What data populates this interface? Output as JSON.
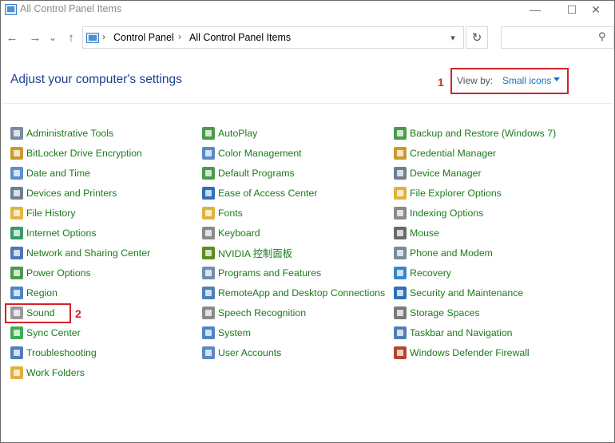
{
  "window": {
    "title": "All Control Panel Items",
    "controls": {
      "minimize": "—",
      "maximize": "☐",
      "close": "✕"
    }
  },
  "nav": {
    "back": "←",
    "forward": "→",
    "recent": "⌄",
    "up": "↑",
    "breadcrumb": [
      "Control Panel",
      "All Control Panel Items"
    ],
    "refresh": "↻",
    "search_placeholder": ""
  },
  "header": {
    "title": "Adjust your computer's settings",
    "view_by_label": "View by:",
    "view_by_value": "Small icons"
  },
  "annotations": {
    "view_by_marker": "1",
    "sound_marker": "2",
    "color": "#d3222b"
  },
  "items": {
    "col1": [
      {
        "label": "Administrative Tools",
        "icon": "admin-tools-icon",
        "color": "#7a8aa0"
      },
      {
        "label": "BitLocker Drive Encryption",
        "icon": "bitlocker-icon",
        "color": "#c99a2e"
      },
      {
        "label": "Date and Time",
        "icon": "clock-icon",
        "color": "#5b8fcf"
      },
      {
        "label": "Devices and Printers",
        "icon": "printer-icon",
        "color": "#6f7f8f"
      },
      {
        "label": "File History",
        "icon": "file-history-icon",
        "color": "#e3b53d"
      },
      {
        "label": "Internet Options",
        "icon": "globe-icon",
        "color": "#3a9a6a"
      },
      {
        "label": "Network and Sharing Center",
        "icon": "network-icon",
        "color": "#4a78b8"
      },
      {
        "label": "Power Options",
        "icon": "battery-icon",
        "color": "#4c9a4c"
      },
      {
        "label": "Region",
        "icon": "region-icon",
        "color": "#4f86c6"
      },
      {
        "label": "Sound",
        "icon": "speaker-icon",
        "color": "#9a9a9a"
      },
      {
        "label": "Sync Center",
        "icon": "sync-icon",
        "color": "#3cae4f"
      },
      {
        "label": "Troubleshooting",
        "icon": "troubleshoot-icon",
        "color": "#4f7fb8"
      },
      {
        "label": "Work Folders",
        "icon": "folder-icon",
        "color": "#e2b13c"
      }
    ],
    "col2": [
      {
        "label": "AutoPlay",
        "icon": "autoplay-icon",
        "color": "#4c9a4c"
      },
      {
        "label": "Color Management",
        "icon": "color-icon",
        "color": "#5a8ac6"
      },
      {
        "label": "Default Programs",
        "icon": "default-programs-icon",
        "color": "#4c9a4c"
      },
      {
        "label": "Ease of Access Center",
        "icon": "accessibility-icon",
        "color": "#2f6fb8"
      },
      {
        "label": "Fonts",
        "icon": "fonts-icon",
        "color": "#e0b43a"
      },
      {
        "label": "Keyboard",
        "icon": "keyboard-icon",
        "color": "#8a8a8a"
      },
      {
        "label": "NVIDIA 控制面板",
        "icon": "nvidia-icon",
        "color": "#5a8f1f"
      },
      {
        "label": "Programs and Features",
        "icon": "programs-icon",
        "color": "#6f8fb0"
      },
      {
        "label": "RemoteApp and Desktop Connections",
        "icon": "remote-icon",
        "color": "#4f7fb8"
      },
      {
        "label": "Speech Recognition",
        "icon": "microphone-icon",
        "color": "#8a8a8a"
      },
      {
        "label": "System",
        "icon": "system-icon",
        "color": "#4f86c6"
      },
      {
        "label": "User Accounts",
        "icon": "users-icon",
        "color": "#5a8ac6"
      }
    ],
    "col3": [
      {
        "label": "Backup and Restore (Windows 7)",
        "icon": "backup-icon",
        "color": "#4c9a4c"
      },
      {
        "label": "Credential Manager",
        "icon": "credential-icon",
        "color": "#c99a2e"
      },
      {
        "label": "Device Manager",
        "icon": "device-manager-icon",
        "color": "#6f7f8f"
      },
      {
        "label": "File Explorer Options",
        "icon": "folder-options-icon",
        "color": "#e2b13c"
      },
      {
        "label": "Indexing Options",
        "icon": "indexing-icon",
        "color": "#8a8a8a"
      },
      {
        "label": "Mouse",
        "icon": "mouse-icon",
        "color": "#6a6a6a"
      },
      {
        "label": "Phone and Modem",
        "icon": "phone-icon",
        "color": "#7a8a9a"
      },
      {
        "label": "Recovery",
        "icon": "recovery-icon",
        "color": "#3a86c8"
      },
      {
        "label": "Security and Maintenance",
        "icon": "flag-icon",
        "color": "#2f6fb8"
      },
      {
        "label": "Storage Spaces",
        "icon": "storage-icon",
        "color": "#7a7a7a"
      },
      {
        "label": "Taskbar and Navigation",
        "icon": "taskbar-icon",
        "color": "#4f7fb8"
      },
      {
        "label": "Windows Defender Firewall",
        "icon": "firewall-icon",
        "color": "#b5462b"
      }
    ]
  }
}
